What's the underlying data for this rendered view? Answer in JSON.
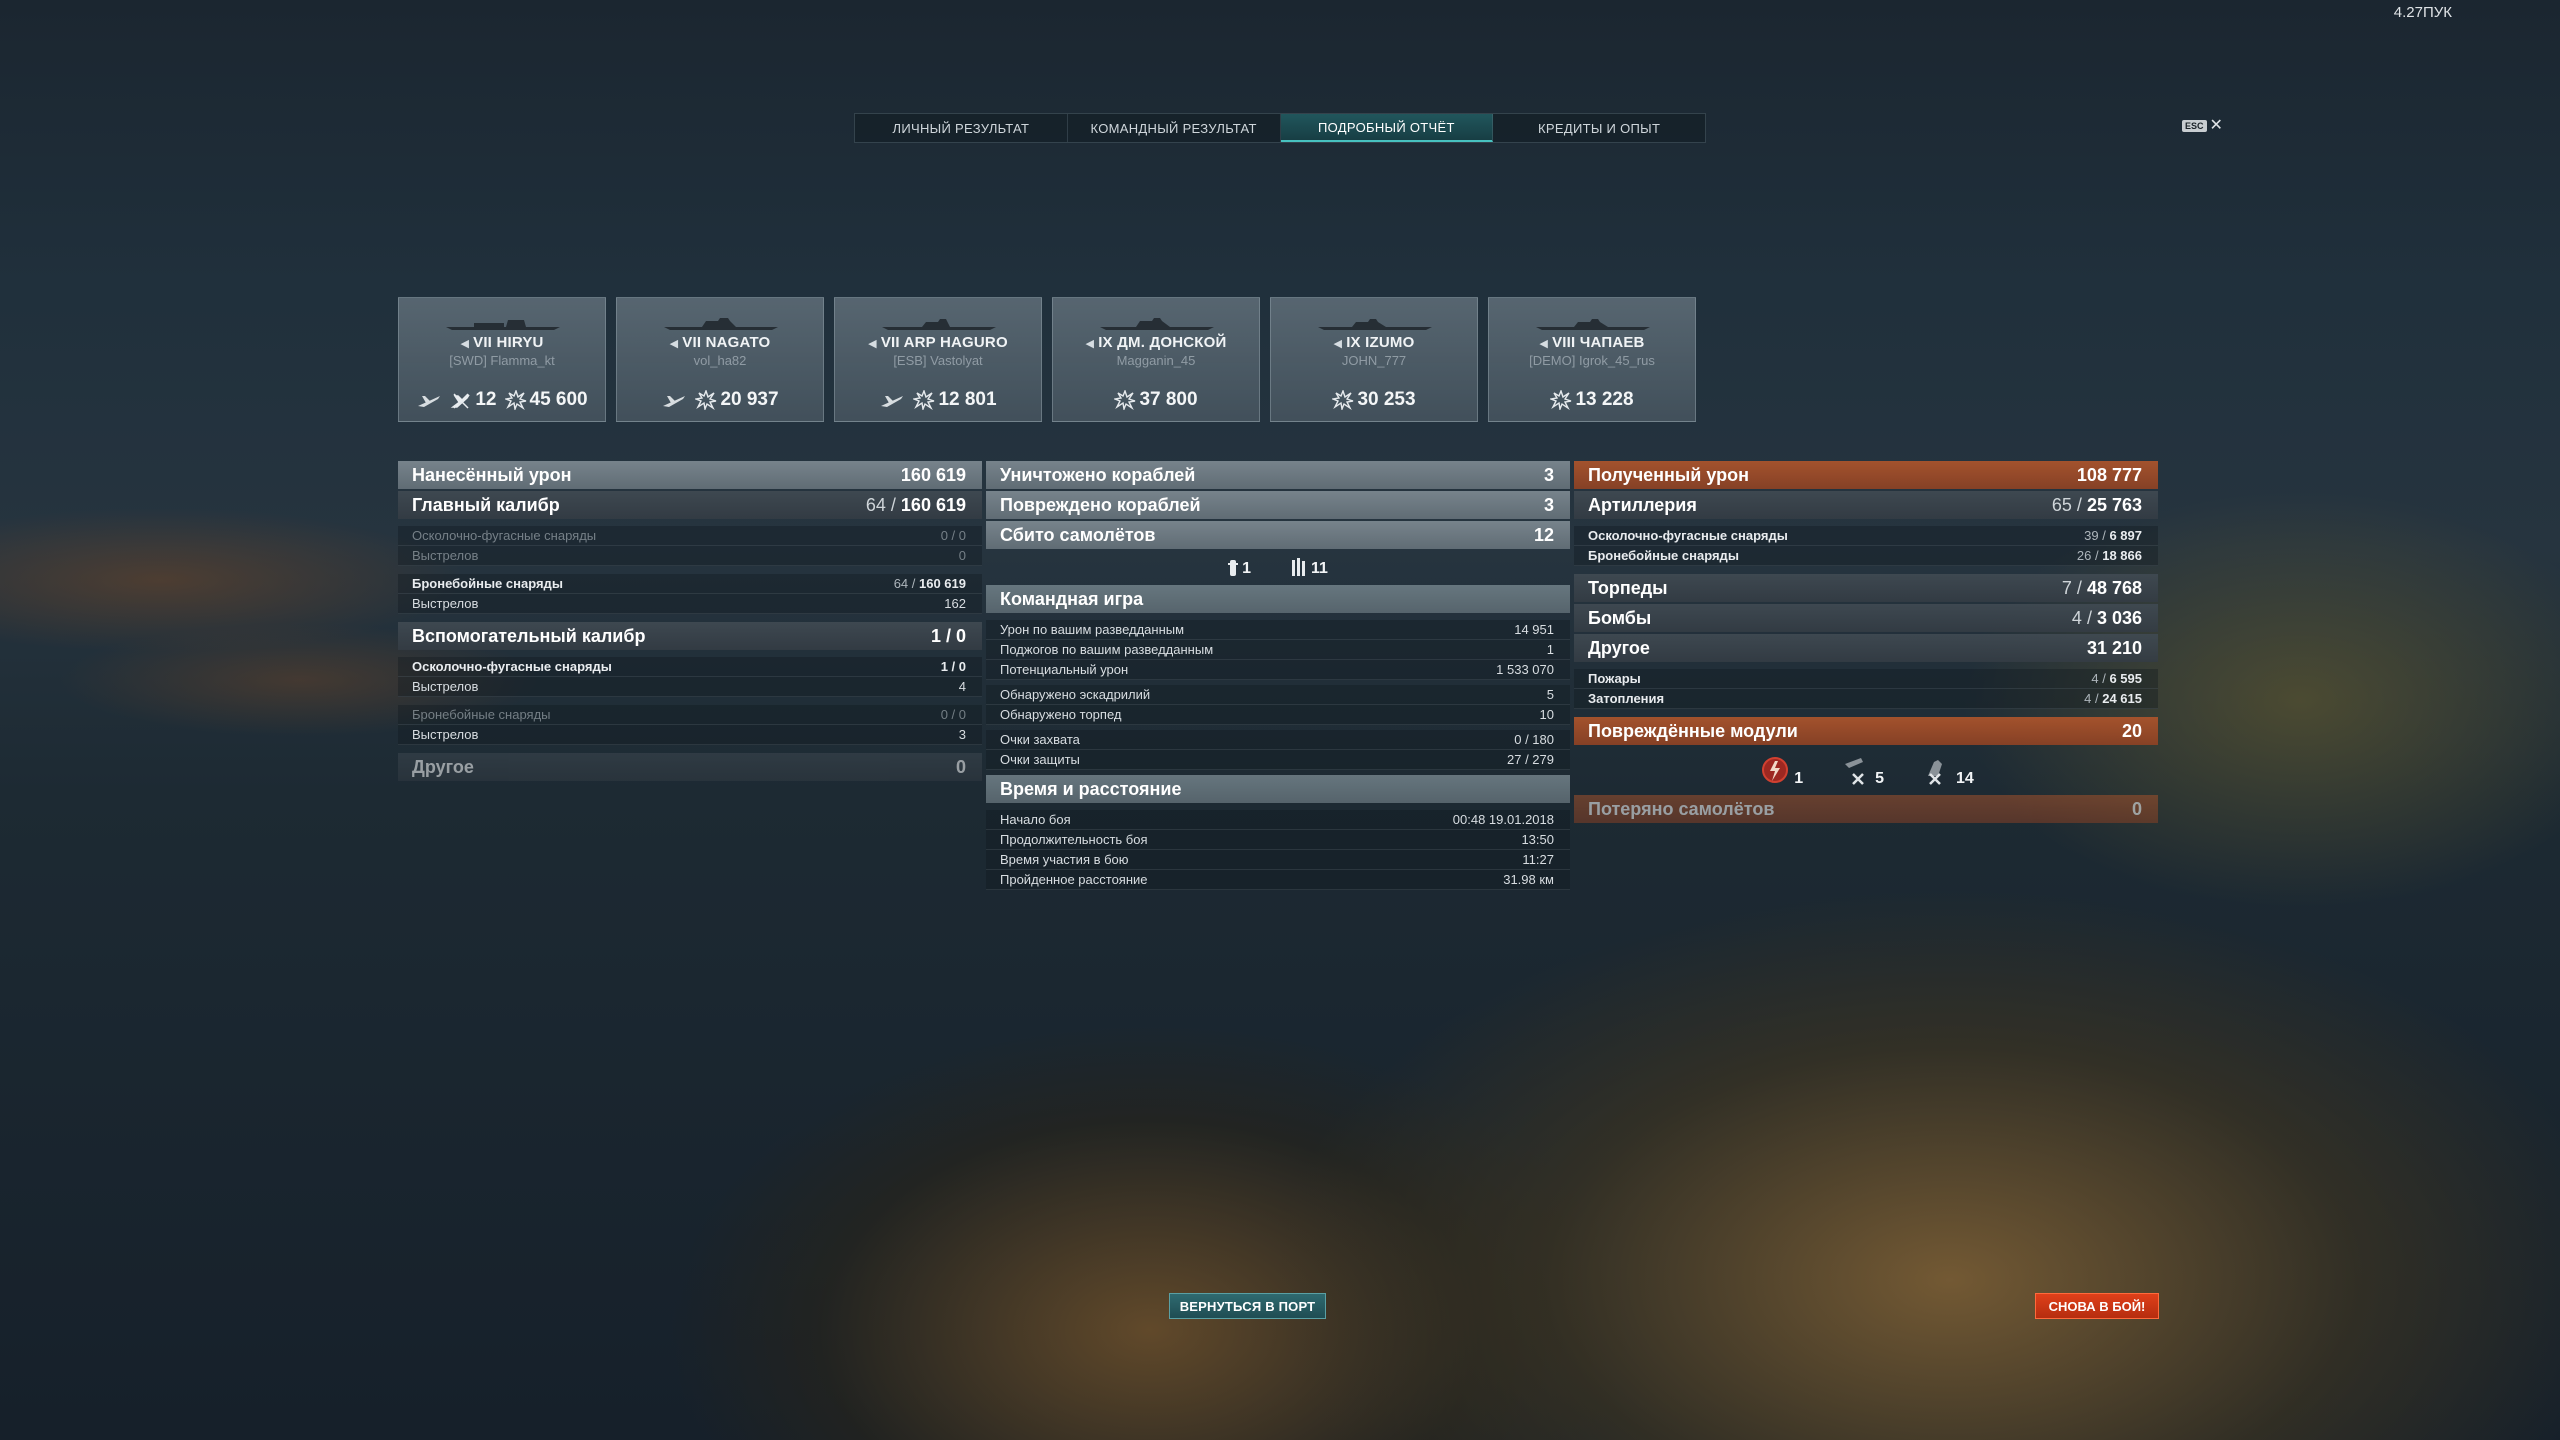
{
  "fps": "4.27ПУК",
  "tabs": [
    {
      "label": "ЛИЧНЫЙ РЕЗУЛЬТАТ"
    },
    {
      "label": "КОМАНДНЫЙ РЕЗУЛЬТАТ"
    },
    {
      "label": "ПОДРОБНЫЙ ОТЧЁТ",
      "active": true
    },
    {
      "label": "КРЕДИТЫ И ОПЫТ"
    }
  ],
  "esc": {
    "key": "ESC",
    "close": "✕"
  },
  "ships": [
    {
      "tier": "VII",
      "name": "HIRYU",
      "nation_icon": "japan-flag-icon",
      "player": "[SWD] Flamma_kt",
      "planes_icon": "aircraft-icon",
      "kills": "12",
      "damage": "45 600"
    },
    {
      "tier": "VII",
      "name": "NAGATO",
      "nation_icon": "japan-flag-icon",
      "player": "vol_ha82",
      "planes_icon": "aircraft-icon",
      "damage": "20 937"
    },
    {
      "tier": "VII",
      "name": "ARP HAGURO",
      "nation_icon": "japan-flag-icon",
      "player": "[ESB] Vastolyat",
      "planes_icon": "aircraft-icon",
      "damage": "12 801"
    },
    {
      "tier": "IX",
      "name": "ДМ. ДОНСКОЙ",
      "nation_icon": "ussr-flag-icon",
      "player": "Magganin_45",
      "damage": "37 800"
    },
    {
      "tier": "IX",
      "name": "IZUMO",
      "nation_icon": "japan-flag-icon",
      "player": "JOHN_777",
      "damage": "30 253"
    },
    {
      "tier": "VIII",
      "name": "ЧАПАЕВ",
      "nation_icon": "ussr-flag-icon",
      "player": "[DEMO] Igrok_45_rus",
      "damage": "13 228"
    }
  ],
  "left": {
    "dealt": {
      "label": "Нанесённый урон",
      "value": "160 619"
    },
    "main": {
      "label": "Главный калибр",
      "hits": "64",
      "value": "160 619"
    },
    "he": {
      "label": "Осколочно-фугасные снаряды",
      "value": "0 / 0"
    },
    "he_shots": {
      "label": "Выстрелов",
      "value": "0"
    },
    "ap": {
      "label": "Бронебойные снаряды",
      "hits": "64",
      "value": "160 619"
    },
    "ap_shots": {
      "label": "Выстрелов",
      "value": "162"
    },
    "secondary": {
      "label": "Вспомогательный калибр",
      "value": "1 / 0"
    },
    "sec_he": {
      "label": "Осколочно-фугасные снаряды",
      "value": "1 / 0"
    },
    "sec_he_shots": {
      "label": "Выстрелов",
      "value": "4"
    },
    "sec_ap": {
      "label": "Бронебойные снаряды",
      "value": "0 / 0"
    },
    "sec_ap_shots": {
      "label": "Выстрелов",
      "value": "3"
    },
    "other": {
      "label": "Другое",
      "value": "0"
    }
  },
  "mid": {
    "destroyed": {
      "label": "Уничтожено кораблей",
      "value": "3"
    },
    "damaged": {
      "label": "Повреждено кораблей",
      "value": "3"
    },
    "planes": {
      "label": "Сбито самолётов",
      "value": "12"
    },
    "icons": [
      {
        "icon": "fighter-icon",
        "value": "1"
      },
      {
        "icon": "torpedo-bomber-icon",
        "value": "11"
      }
    ],
    "team": {
      "label": "Командная игра"
    },
    "team_rows": [
      {
        "label": "Урон по вашим разведданным",
        "value": "14 951"
      },
      {
        "label": "Поджогов по вашим разведданным",
        "value": "1"
      },
      {
        "label": "Потенциальный урон",
        "value": "1 533 070"
      },
      {
        "label": "Обнаружено эскадрилий",
        "value": "5"
      },
      {
        "label": "Обнаружено торпед",
        "value": "10"
      },
      {
        "label": "Очки захвата",
        "value": "0 / 180"
      },
      {
        "label": "Очки защиты",
        "value": "27 / 279"
      }
    ],
    "time": {
      "label": "Время и расстояние"
    },
    "time_rows": [
      {
        "label": "Начало боя",
        "value": "00:48  19.01.2018"
      },
      {
        "label": "Продолжительность боя",
        "value": "13:50"
      },
      {
        "label": "Время участия в бою",
        "value": "11:27"
      },
      {
        "label": "Пройденное расстояние",
        "value": "31.98 км"
      }
    ]
  },
  "right": {
    "received": {
      "label": "Полученный урон",
      "value": "108 777"
    },
    "artillery": {
      "label": "Артиллерия",
      "hits": "65",
      "value": "25 763"
    },
    "he": {
      "label": "Осколочно-фугасные снаряды",
      "hits": "39",
      "value": "6 897"
    },
    "ap": {
      "label": "Бронебойные снаряды",
      "hits": "26",
      "value": "18 866"
    },
    "torpedoes": {
      "label": "Торпеды",
      "hits": "7",
      "value": "48 768"
    },
    "bombs": {
      "label": "Бомбы",
      "hits": "4",
      "value": "3 036"
    },
    "other": {
      "label": "Другое",
      "value": "31 210"
    },
    "fires": {
      "label": "Пожары",
      "hits": "4",
      "value": "6 595"
    },
    "floods": {
      "label": "Затопления",
      "hits": "4",
      "value": "24 615"
    },
    "modules": {
      "label": "Повреждённые модули",
      "value": "20"
    },
    "module_icons": [
      {
        "icon": "engine-damage-icon",
        "value": "1"
      },
      {
        "icon": "gun-damage-icon",
        "value": "5"
      },
      {
        "icon": "aa-damage-icon",
        "value": "14"
      }
    ],
    "planes_lost": {
      "label": "Потеряно самолётов",
      "value": "0"
    }
  },
  "buttons": {
    "port": "ВЕРНУТЬСЯ В ПОРТ",
    "battle": "СНОВА В БОЙ!"
  }
}
